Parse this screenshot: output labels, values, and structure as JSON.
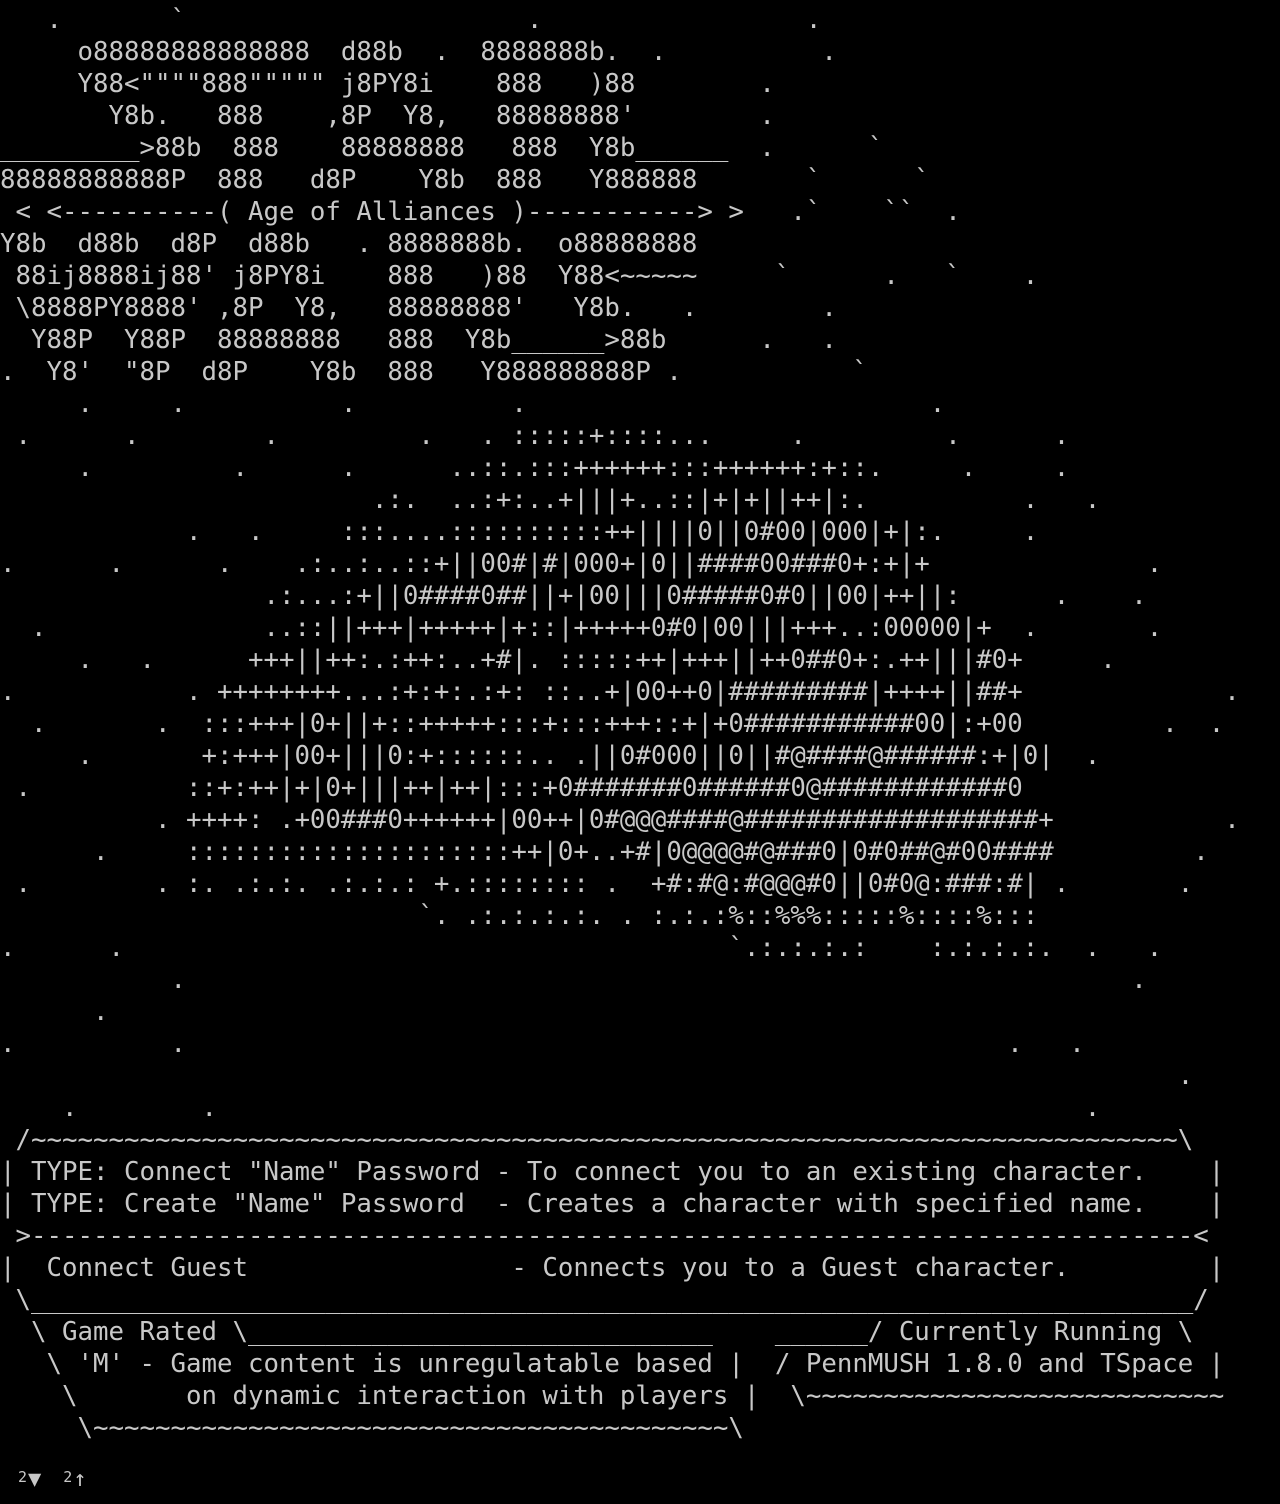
{
  "terminal": {
    "screen_lines": [
      "   .       `                      .                 .",
      "     o88888888888888  d88b  .  8888888b.  .          .",
      "     Y88<\"\"\"\"888\"\"\"\"\" j8PY8i    888   )88        .",
      "       Y8b.   888    ,8P  Y8,   88888888'        .",
      "_________>88b  888    88888888   888  Y8b______  .      `",
      "88888888888P  888   d8P    Y8b  888   Y888888       `      `",
      " < <----------( Age of Alliances )-----------> >   .`    ``  .",
      "Y8b  d88b  d8P  d88b   . 8888888b.  o88888888",
      " 88ij8888ij88' j8PY8i    888   )88  Y88<~~~~~     `      .   `    .",
      " \\8888PY8888' ,8P  Y8,   88888888'   Y8b.   .        .",
      "  Y88P  Y88P  88888888   888  Y8b______>88b      .   .",
      ".  Y8'  \"8P  d8P    Y8b  888   Y888888888P .           `",
      "     .     .          .          .                          .",
      " .      .        .         .   . :::::+::::...     .         .      .",
      "     .         .      .      ..::.:::++++++:::++++++:+::.     .     .",
      "                        .:.  ..:+:..+|||+..::|+|+||++|:.          .   .",
      "            .   .     :::....::::::::::++||||0||0#00|000|+|:.     .",
      ".      .      .    .:..:..::+||00#|#|000+|0||####00###0+:+|+              .",
      "                 .:...:+||0####0##||+|00|||0#####0#0||00|++||:      .    .",
      "  .              ..::||+++|+++++|+::|+++++0#0|00|||+++..:00000|+  .       .",
      "     .   .      +++||++:.:++:..+#|. :::::++|+++||++0##0+:.++|||#0+     .",
      ".           . ++++++++...:+:+:.:+: ::..+|00++0|#########|++++||##+             .",
      "  .       .  :::+++|0+||+::+++++:::+:::+++::+|+0###########00|:+00         .  .",
      "     .       +:+++|00+|||0:+::::::.. .||0#000||0||#@####@######:+|0|  .",
      " .          ::+:++|+|0+|||++|++|:::+0#######0######0@############0",
      "          . ++++: .+00###0++++++|00++|0#@@@####@###################+           .",
      "      .     :::::::::::::::::::::++|0+..+#|0@@@@#@###0|0#0##@#00####         .",
      " .        . :. .:.:. .:.:.: +.:::::::: .  +#:#@:#@@@#0||0#0@:###:#| .       .",
      "                           `. .:.:.:.:. . :.:.:%::%%%:::::%::::%:::",
      ".      .                                       `.:.:.:.:    :.:.:.:.  .   .",
      "           .                                                             .",
      "      .",
      ".          .                                                     .   .",
      "                                                                            .",
      "    .        .                                                        .",
      " /~~~~~~~~~~~~~~~~~~~~~~~~~~~~~~~~~~~~~~~~~~~~~~~~~~~~~~~~~~~~~~~~~~~~~~~~~~\\",
      "| TYPE: Connect \"Name\" Password - To connect you to an existing character.    |",
      "| TYPE: Create \"Name\" Password  - Creates a character with specified name.    |",
      " >---------------------------------------------------------------------------<",
      "|  Connect Guest                 - Connects you to a Guest character.         |",
      " \\___________________________________________________________________________/",
      "  \\ Game Rated \\______________________________    ______/ Currently Running \\",
      "   \\ 'M' - Game content is unregulatable based |  / PennMUSH 1.8.0 and TSpace |",
      "    \\       on dynamic interaction with players |  \\~~~~~~~~~~~~~~~~~~~~~~~~~~~",
      "     \\~~~~~~~~~~~~~~~~~~~~~~~~~~~~~~~~~~~~~~~~~\\"
    ]
  },
  "status_bar": {
    "left_indicator": {
      "count": "2",
      "icon": "triangle-down-icon",
      "glyph": "▼"
    },
    "right_indicator": {
      "count": "2",
      "icon": "arrow-up-icon",
      "glyph": "↑"
    }
  },
  "colors": {
    "background": "#000000",
    "foreground": "#c8c8c8"
  }
}
